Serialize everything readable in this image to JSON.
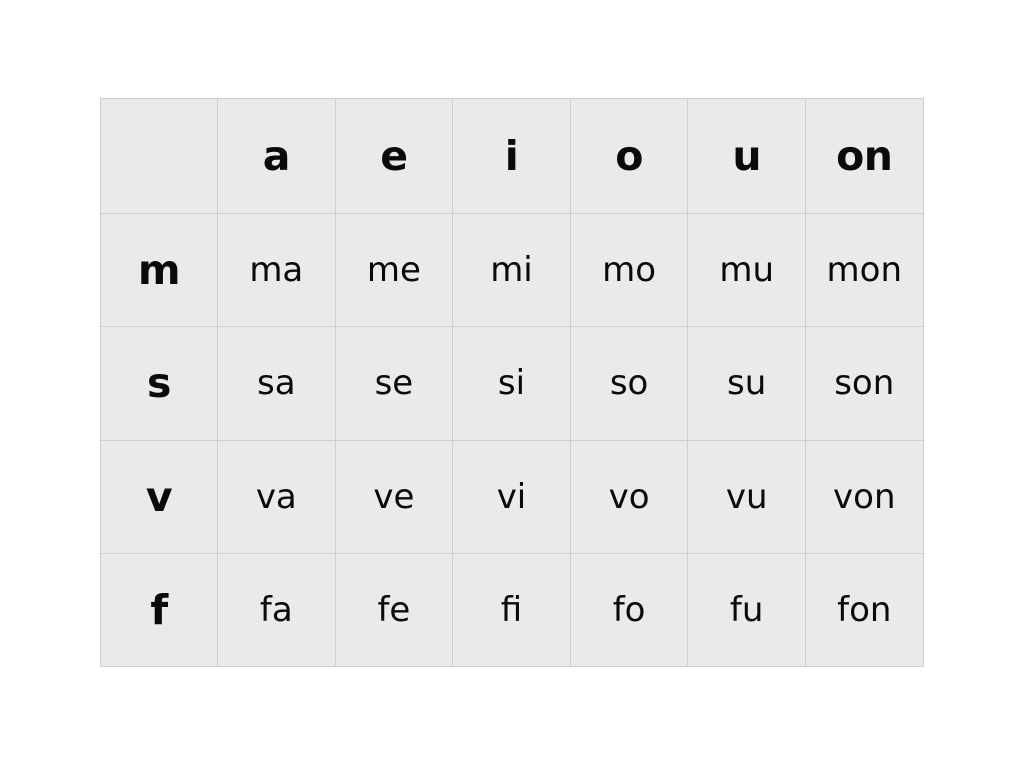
{
  "page": {
    "background_color": "#ffffff",
    "table_background_color": "#eaeaea",
    "border_color": "#cfcfcf",
    "text_color": "#0a0a0a"
  },
  "table": {
    "corner_label": "",
    "column_headers": [
      "a",
      "e",
      "i",
      "o",
      "u",
      "on"
    ],
    "row_labels": [
      "m",
      "s",
      "v",
      "f"
    ],
    "rows": [
      {
        "label": "m",
        "cells": [
          "ma",
          "me",
          "mi",
          "mo",
          "mu",
          "mon"
        ]
      },
      {
        "label": "s",
        "cells": [
          "sa",
          "se",
          "si",
          "so",
          "su",
          "son"
        ]
      },
      {
        "label": "v",
        "cells": [
          "va",
          "ve",
          "vi",
          "vo",
          "vu",
          "von"
        ]
      },
      {
        "label": "f",
        "cells": [
          "fa",
          "fe",
          "fi",
          "fo",
          "fu",
          "fon"
        ]
      }
    ]
  }
}
